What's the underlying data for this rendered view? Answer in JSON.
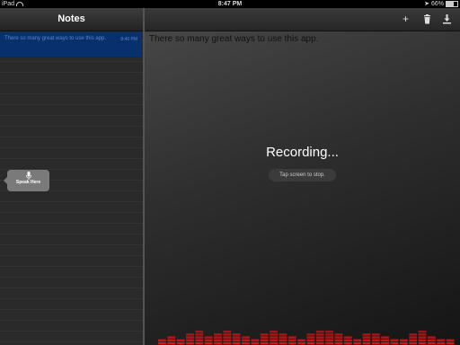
{
  "status_bar": {
    "carrier": "iPad",
    "time": "8:47 PM",
    "battery": "66%",
    "battery_level": 0.66
  },
  "sidebar": {
    "title": "Notes",
    "notes": [
      {
        "preview": "There so many great ways to use this app.",
        "time": "8:46 PM"
      }
    ],
    "speak_button": "Speak Here"
  },
  "toolbar": {
    "add_icon": "plus-icon",
    "trash_icon": "trash-icon",
    "share_icon": "download-icon"
  },
  "editor": {
    "text": "There so many great ways to use this app."
  },
  "recording": {
    "label": "Recording...",
    "hint": "Tap screen to stop."
  },
  "colors": {
    "selected_note": "#08306d",
    "meter": "#d41414"
  },
  "meter_levels": [
    0.3,
    0.5,
    0.4,
    0.6,
    0.8,
    0.5,
    0.7,
    0.9,
    0.6,
    0.5,
    0.4,
    0.7,
    0.8,
    0.6,
    0.5,
    0.3,
    0.6,
    0.8,
    0.9,
    0.7,
    0.5,
    0.4,
    0.6,
    0.7,
    0.5,
    0.3,
    0.4,
    0.6,
    0.8,
    0.5,
    0.4,
    0.3
  ]
}
